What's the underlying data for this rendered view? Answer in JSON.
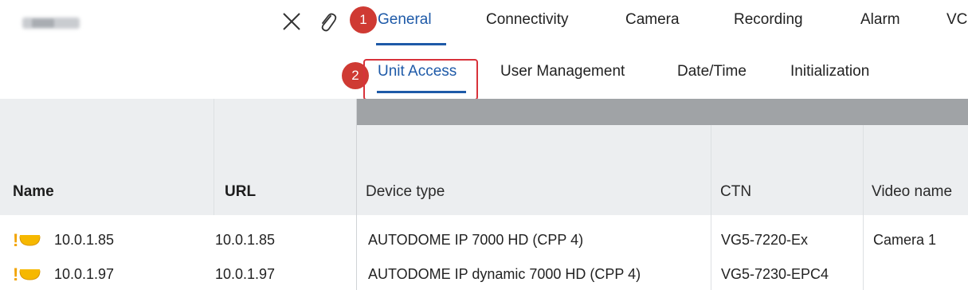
{
  "topbar": {
    "tabs": [
      {
        "label": "General",
        "active": true
      },
      {
        "label": "Connectivity",
        "active": false
      },
      {
        "label": "Camera",
        "active": false
      },
      {
        "label": "Recording",
        "active": false
      },
      {
        "label": "Alarm",
        "active": false
      },
      {
        "label": "VC",
        "active": false
      }
    ],
    "icons": [
      "close-icon",
      "paperclip-icon"
    ]
  },
  "subtabs": [
    {
      "label": "Unit Access",
      "active": true
    },
    {
      "label": "User Management",
      "active": false
    },
    {
      "label": "Date/Time",
      "active": false
    },
    {
      "label": "Initialization",
      "active": false
    }
  ],
  "callouts": [
    "1",
    "2"
  ],
  "table": {
    "columns": [
      "Name",
      "URL",
      "Device type",
      "CTN",
      "Video name"
    ],
    "rows": [
      {
        "name": "10.0.1.85",
        "url": "10.0.1.85",
        "device_type": "AUTODOME IP 7000 HD (CPP 4)",
        "ctn": "VG5-7220-Ex",
        "video_name": "Camera 1"
      },
      {
        "name": "10.0.1.97",
        "url": "10.0.1.97",
        "device_type": "AUTODOME IP dynamic 7000 HD (CPP 4)",
        "ctn": "VG5-7230-EPC4",
        "video_name": ""
      }
    ]
  },
  "colors": {
    "accent": "#1e5aa8",
    "callout": "#cf3a33",
    "warning": "#f2a300",
    "header_bg": "#eceef0",
    "band": "#a0a3a6"
  }
}
